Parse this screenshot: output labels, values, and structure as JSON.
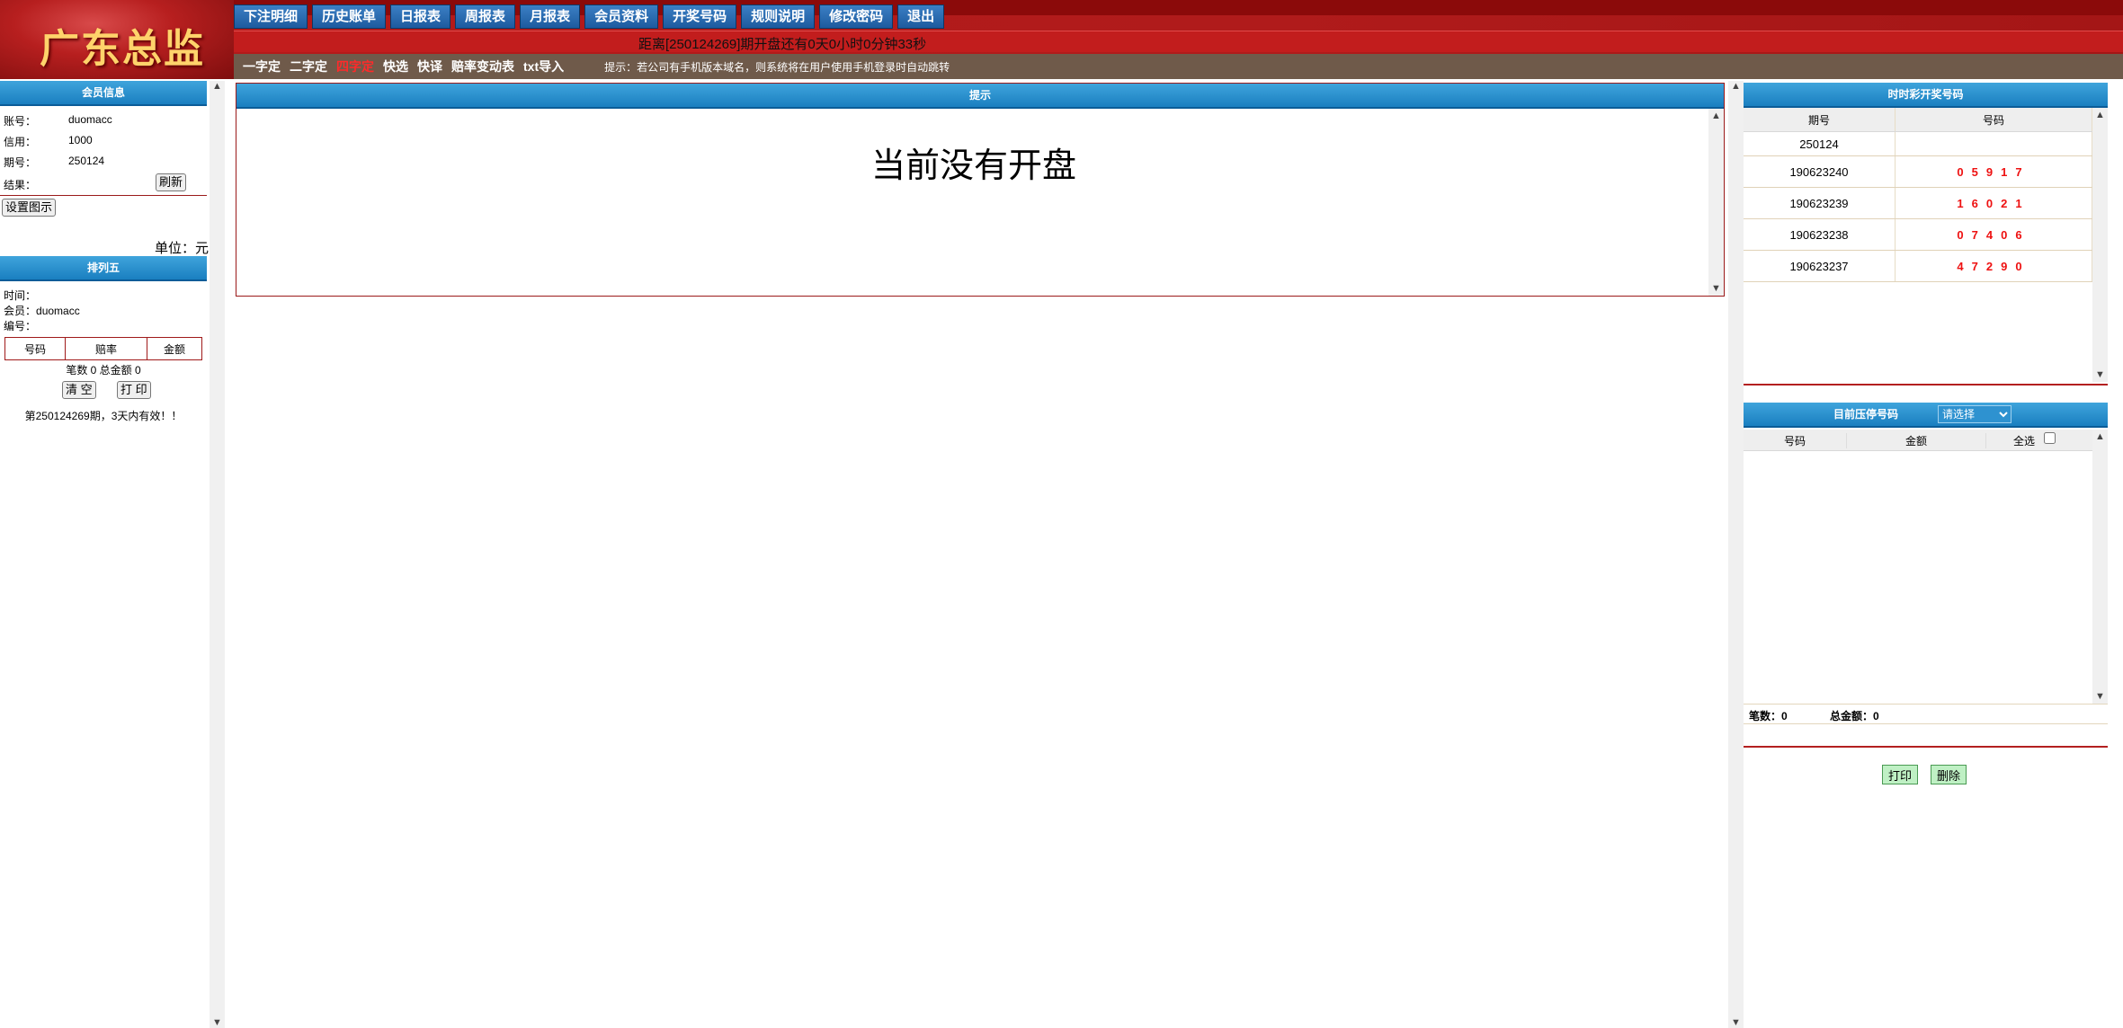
{
  "logo": {
    "text": "广东总监"
  },
  "nav": [
    "下注明细",
    "历史账单",
    "日报表",
    "周报表",
    "月报表",
    "会员资料",
    "开奖号码",
    "规则说明",
    "修改密码",
    "退出"
  ],
  "countdown": "距离[250124269]期开盘还有0天0小时0分钟33秒",
  "subnav": {
    "items": [
      "一字定",
      "二字定",
      "四字定",
      "快选",
      "快译",
      "赔率变动表",
      "txt导入"
    ],
    "active_index": 2,
    "tip": "提示：若公司有手机版本域名，则系统将在用户使用手机登录时自动跳转"
  },
  "member": {
    "title": "会员信息",
    "account_label": "账号：",
    "account": "duomacc",
    "credit_label": "信用：",
    "credit": "1000",
    "period_label": "期号：",
    "period": "250124",
    "result_label": "结果：",
    "refresh_btn": "刷新",
    "settings_btn": "设置图示",
    "unit": "单位：元"
  },
  "slip": {
    "title": "排列五",
    "time_label": "时间：",
    "time": "",
    "member_label": "会员：",
    "member": "duomacc",
    "code_label": "编号：",
    "code": "",
    "headers": [
      "号码",
      "赔率",
      "金额"
    ],
    "summary": "笔数 0 总金额 0",
    "clear_btn": "清 空",
    "print_btn": "打 印",
    "valid_note": "第250124269期，3天内有效！！"
  },
  "notice": {
    "title": "提示",
    "message": "当前没有开盘"
  },
  "draws": {
    "title": "时时彩开奖号码",
    "headers": [
      "期号",
      "号码"
    ],
    "rows": [
      {
        "period": "250124",
        "number": ""
      },
      {
        "period": "190623240",
        "number": "05917"
      },
      {
        "period": "190623239",
        "number": "16021"
      },
      {
        "period": "190623238",
        "number": "07406"
      },
      {
        "period": "190623237",
        "number": "47290"
      }
    ]
  },
  "limits": {
    "title": "目前压停号码",
    "select_value": "请选择",
    "headers": [
      "号码",
      "金额",
      "全选"
    ],
    "count_label": "笔数：",
    "count": "0",
    "total_label": "总金额：",
    "total": "0",
    "print_btn": "打印",
    "delete_btn": "删除"
  }
}
